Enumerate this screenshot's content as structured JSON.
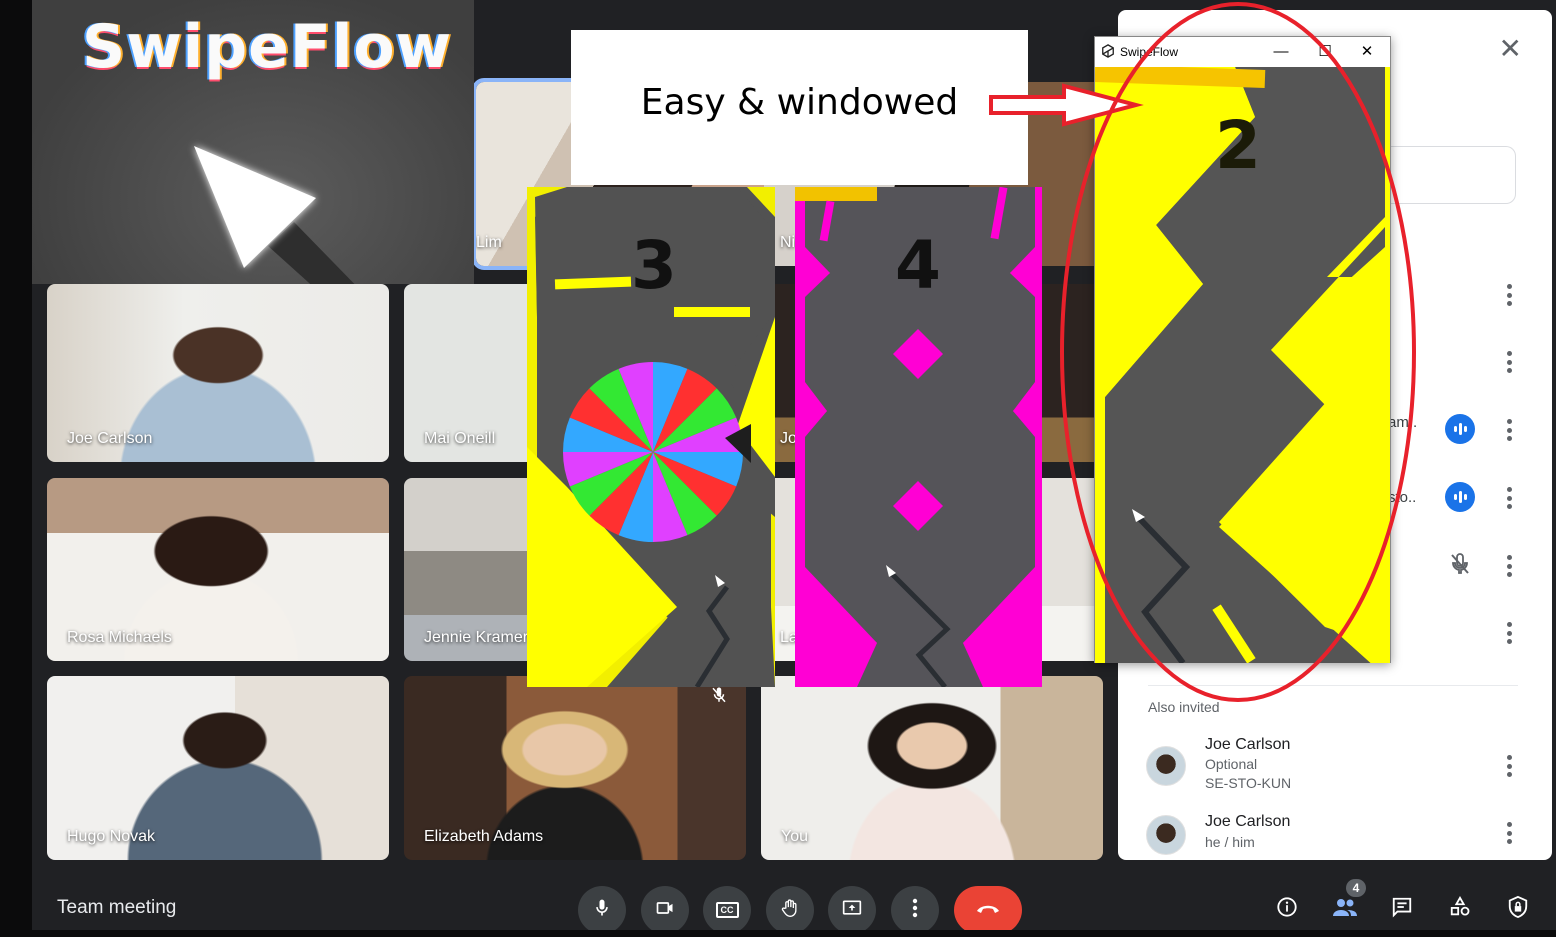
{
  "meeting": {
    "title": "Team meeting"
  },
  "logo": {
    "title": "SwipeFlow"
  },
  "annotation": {
    "caption": "Easy & windowed"
  },
  "games": [
    {
      "score": "3",
      "theme": "yellow",
      "accent": "#ffff00"
    },
    {
      "score": "4",
      "theme": "magenta",
      "accent": "#ff00d4"
    },
    {
      "score": "2",
      "theme": "yellow",
      "accent": "#ffff00"
    }
  ],
  "unity_window": {
    "title": "SwipeFlow",
    "minimize_label": "—",
    "maximize_label": "☐",
    "close_label": "✕"
  },
  "tiles": [
    {
      "name": "Lim",
      "speaking": true
    },
    {
      "name": "Ni",
      "speaking": false
    },
    {
      "name": "Joe Carlson"
    },
    {
      "name": "Mai Oneill"
    },
    {
      "name": "Jo"
    },
    {
      "name": "Rosa Michaels"
    },
    {
      "name": "Jennie Kramer"
    },
    {
      "name": "La"
    },
    {
      "name": "Hugo Novak"
    },
    {
      "name": "Elizabeth Adams",
      "muted": true
    },
    {
      "name": "You"
    }
  ],
  "people_panel": {
    "close_label": "✕",
    "rows": [
      {
        "truncated_text": "",
        "status": "none"
      },
      {
        "truncated_text": "",
        "status": "none"
      },
      {
        "truncated_text": "am..",
        "status": "speaking"
      },
      {
        "truncated_text": "sto..",
        "status": "speaking"
      },
      {
        "truncated_text": "",
        "status": "muted"
      },
      {
        "truncated_text": "",
        "status": "none"
      }
    ],
    "also_invited_label": "Also invited",
    "invited": [
      {
        "name": "Joe Carlson",
        "line1": "Optional",
        "line2": "SE-STO-KUN"
      },
      {
        "name": "Joe Carlson",
        "line1": "he / him",
        "line2": ""
      }
    ]
  },
  "controls": {
    "mic": "microphone-icon",
    "camera": "camera-icon",
    "captions": "CC",
    "raise_hand": "hand-icon",
    "present": "present-icon",
    "more": "more-icon",
    "end_call": "end-call-icon"
  },
  "right_controls": {
    "people_count": "4"
  },
  "colors": {
    "accent_blue": "#1a73e8",
    "end_call_red": "#ea4335",
    "annotation_red": "#e8212b",
    "speaking_outline": "#8ab4f8"
  }
}
